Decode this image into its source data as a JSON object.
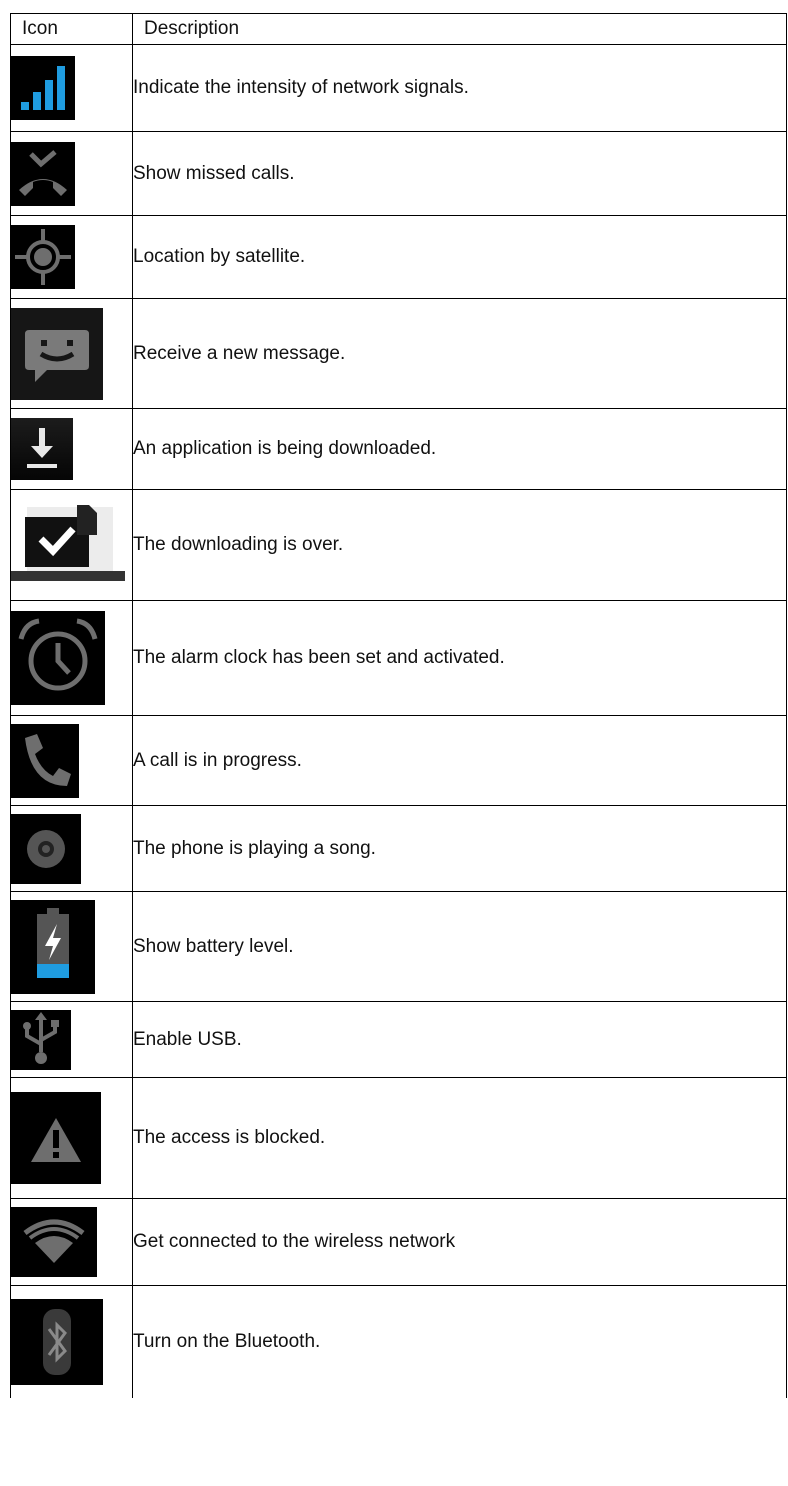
{
  "header": {
    "icon_col": "Icon",
    "description_col": "Description"
  },
  "rows": [
    {
      "icon": "signal-strength-icon",
      "description": "Indicate the intensity of network signals."
    },
    {
      "icon": "missed-call-icon",
      "description": "Show missed calls."
    },
    {
      "icon": "gps-location-icon",
      "description": "Location by satellite."
    },
    {
      "icon": "new-message-icon",
      "description": "Receive a new message."
    },
    {
      "icon": "download-icon",
      "description": "An application is being downloaded."
    },
    {
      "icon": "download-complete-icon",
      "description": "The downloading is over."
    },
    {
      "icon": "alarm-clock-icon",
      "description": "The alarm clock has been set and activated."
    },
    {
      "icon": "call-in-progress-icon",
      "description": "A call is in progress."
    },
    {
      "icon": "music-playing-icon",
      "description": "The phone is playing a song."
    },
    {
      "icon": "battery-level-icon",
      "description": "Show battery level."
    },
    {
      "icon": "usb-icon",
      "description": "Enable USB."
    },
    {
      "icon": "warning-icon",
      "description": "The access is blocked."
    },
    {
      "icon": "wifi-icon",
      "description": "Get connected to the wireless network"
    },
    {
      "icon": "bluetooth-icon",
      "description": "Turn on the Bluetooth."
    }
  ],
  "colors": {
    "icon_bg": "#000000",
    "icon_gray": "#6e6e6e",
    "accent_blue": "#1f9ce0"
  }
}
